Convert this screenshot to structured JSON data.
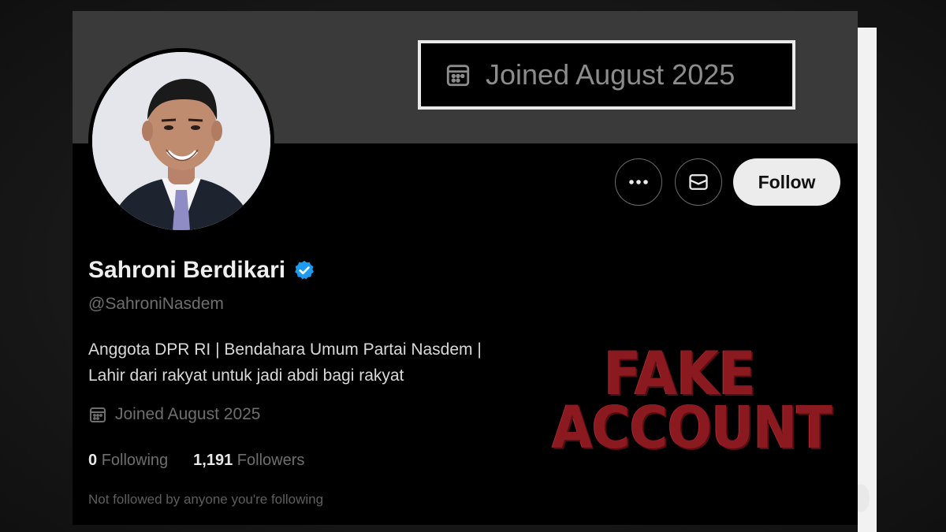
{
  "callout": {
    "joined_text": "Joined August 2025",
    "icon": "calendar-icon"
  },
  "profile": {
    "display_name": "Sahroni Berdikari",
    "verified_icon": "verified-badge-icon",
    "handle": "@SahroniNasdem",
    "bio_line1": "Anggota DPR RI | Bendahara Umum Partai Nasdem |",
    "bio_line2": "Lahir dari rakyat untuk jadi abdi bagi rakyat",
    "joined_text": "Joined August 2025",
    "following_count": "0",
    "following_label": "Following",
    "followers_count": "1,191",
    "followers_label": "Followers",
    "not_followed_text": "Not followed by anyone you're following"
  },
  "actions": {
    "more_icon": "more-horizontal-icon",
    "message_icon": "envelope-icon",
    "follow_label": "Follow"
  },
  "overlay": {
    "line1": "FAKE",
    "line2": "ACCOUNT"
  },
  "colors": {
    "verified": "#1d9bf0",
    "stamp": "#8a1a1f",
    "banner": "#3a3a3a"
  }
}
